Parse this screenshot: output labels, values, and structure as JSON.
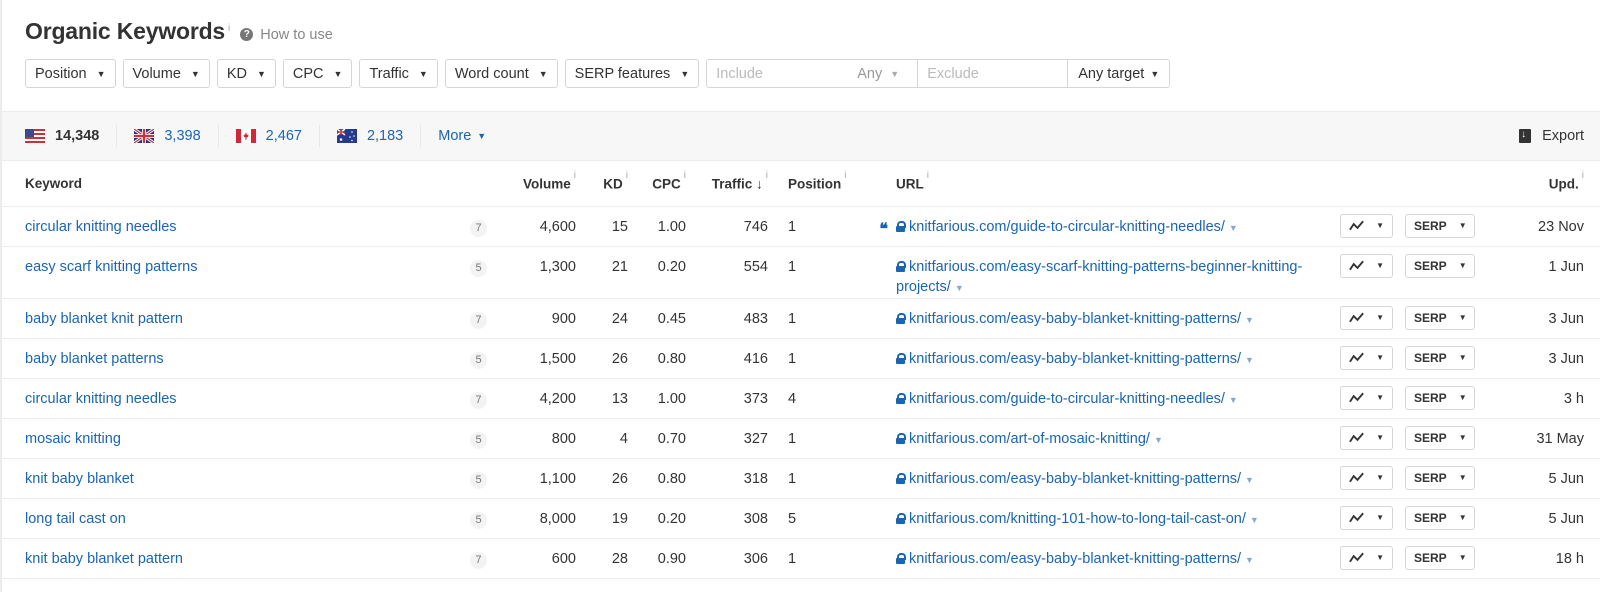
{
  "header": {
    "title": "Organic Keywords",
    "info_glyph": "i",
    "how_to_use": "How to use"
  },
  "filters": {
    "position": "Position",
    "volume": "Volume",
    "kd": "KD",
    "cpc": "CPC",
    "traffic": "Traffic",
    "word_count": "Word count",
    "serp_features": "SERP features",
    "include_placeholder": "Include",
    "any": "Any",
    "exclude_placeholder": "Exclude",
    "any_target": "Any target"
  },
  "countries": [
    {
      "code": "US",
      "count": "14,348",
      "active": true
    },
    {
      "code": "GB",
      "count": "3,398",
      "active": false
    },
    {
      "code": "CA",
      "count": "2,467",
      "active": false
    },
    {
      "code": "AU",
      "count": "2,183",
      "active": false
    }
  ],
  "more_label": "More",
  "export_label": "Export",
  "columns": {
    "keyword": "Keyword",
    "volume": "Volume",
    "kd": "KD",
    "cpc": "CPC",
    "traffic": "Traffic ↓",
    "position": "Position",
    "url": "URL",
    "updated": "Upd."
  },
  "serp_label": "SERP",
  "rows": [
    {
      "keyword": "circular knitting needles",
      "words": "7",
      "volume": "4,600",
      "kd": "15",
      "cpc": "1.00",
      "traffic": "746",
      "position": "1",
      "snippet": true,
      "url": "knitfarious.com/guide-to-circular-knitting-needles/",
      "updated": "23 Nov"
    },
    {
      "keyword": "easy scarf knitting patterns",
      "words": "5",
      "volume": "1,300",
      "kd": "21",
      "cpc": "0.20",
      "traffic": "554",
      "position": "1",
      "snippet": false,
      "url": "knitfarious.com/easy-scarf-knitting-patterns-beginner-knitting-projects/",
      "updated": "1 Jun"
    },
    {
      "keyword": "baby blanket knit pattern",
      "words": "7",
      "volume": "900",
      "kd": "24",
      "cpc": "0.45",
      "traffic": "483",
      "position": "1",
      "snippet": false,
      "url": "knitfarious.com/easy-baby-blanket-knitting-patterns/",
      "updated": "3 Jun"
    },
    {
      "keyword": "baby blanket patterns",
      "words": "5",
      "volume": "1,500",
      "kd": "26",
      "cpc": "0.80",
      "traffic": "416",
      "position": "1",
      "snippet": false,
      "url": "knitfarious.com/easy-baby-blanket-knitting-patterns/",
      "updated": "3 Jun"
    },
    {
      "keyword": "circular knitting needles",
      "words": "7",
      "volume": "4,200",
      "kd": "13",
      "cpc": "1.00",
      "traffic": "373",
      "position": "4",
      "snippet": false,
      "url": "knitfarious.com/guide-to-circular-knitting-needles/",
      "updated": "3 h"
    },
    {
      "keyword": "mosaic knitting",
      "words": "5",
      "volume": "800",
      "kd": "4",
      "cpc": "0.70",
      "traffic": "327",
      "position": "1",
      "snippet": false,
      "url": "knitfarious.com/art-of-mosaic-knitting/",
      "updated": "31 May"
    },
    {
      "keyword": "knit baby blanket",
      "words": "5",
      "volume": "1,100",
      "kd": "26",
      "cpc": "0.80",
      "traffic": "318",
      "position": "1",
      "snippet": false,
      "url": "knitfarious.com/easy-baby-blanket-knitting-patterns/",
      "updated": "5 Jun"
    },
    {
      "keyword": "long tail cast on",
      "words": "5",
      "volume": "8,000",
      "kd": "19",
      "cpc": "0.20",
      "traffic": "308",
      "position": "5",
      "snippet": false,
      "url": "knitfarious.com/knitting-101-how-to-long-tail-cast-on/",
      "updated": "5 Jun"
    },
    {
      "keyword": "knit baby blanket pattern",
      "words": "7",
      "volume": "600",
      "kd": "28",
      "cpc": "0.90",
      "traffic": "306",
      "position": "1",
      "snippet": false,
      "url": "knitfarious.com/easy-baby-blanket-knitting-patterns/",
      "updated": "18 h"
    }
  ]
}
